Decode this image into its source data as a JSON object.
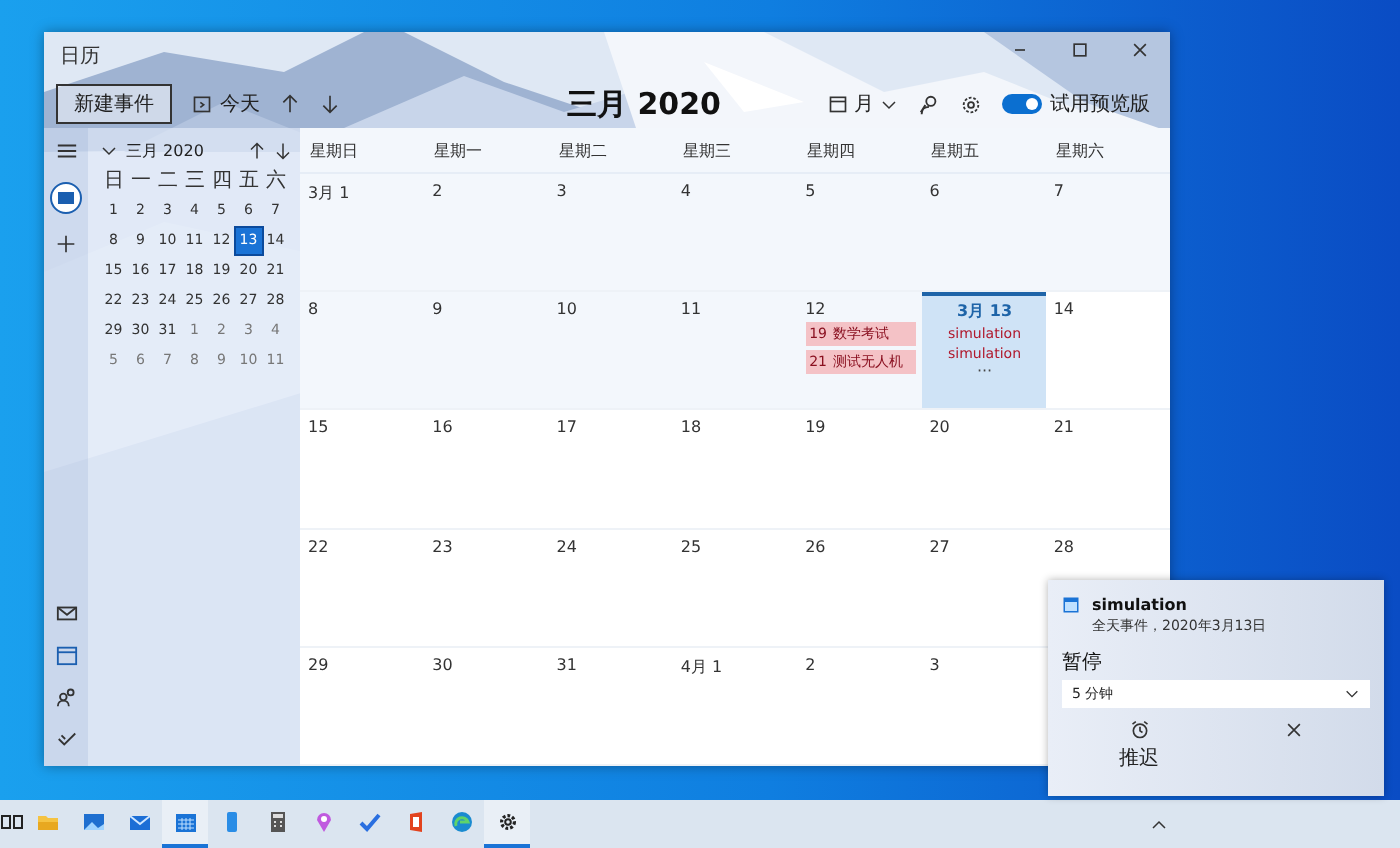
{
  "window": {
    "title": "日历"
  },
  "toolbar": {
    "new_event": "新建事件",
    "today": "今天",
    "month_title": "三月 2020",
    "view": "月",
    "preview_toggle": {
      "label": "试用预览版",
      "on": true
    }
  },
  "mini_calendar": {
    "title": "三月 2020",
    "weekdays": [
      "日",
      "一",
      "二",
      "三",
      "四",
      "五",
      "六"
    ],
    "weeks": [
      [
        {
          "day": "1",
          "in_month": true,
          "selected": false
        },
        {
          "day": "2",
          "in_month": true,
          "selected": false
        },
        {
          "day": "3",
          "in_month": true,
          "selected": false
        },
        {
          "day": "4",
          "in_month": true,
          "selected": false
        },
        {
          "day": "5",
          "in_month": true,
          "selected": false
        },
        {
          "day": "6",
          "in_month": true,
          "selected": false
        },
        {
          "day": "7",
          "in_month": true,
          "selected": false
        }
      ],
      [
        {
          "day": "8",
          "in_month": true,
          "selected": false
        },
        {
          "day": "9",
          "in_month": true,
          "selected": false
        },
        {
          "day": "10",
          "in_month": true,
          "selected": false
        },
        {
          "day": "11",
          "in_month": true,
          "selected": false
        },
        {
          "day": "12",
          "in_month": true,
          "selected": false
        },
        {
          "day": "13",
          "in_month": true,
          "selected": true
        },
        {
          "day": "14",
          "in_month": true,
          "selected": false
        }
      ],
      [
        {
          "day": "15",
          "in_month": true,
          "selected": false
        },
        {
          "day": "16",
          "in_month": true,
          "selected": false
        },
        {
          "day": "17",
          "in_month": true,
          "selected": false
        },
        {
          "day": "18",
          "in_month": true,
          "selected": false
        },
        {
          "day": "19",
          "in_month": true,
          "selected": false
        },
        {
          "day": "20",
          "in_month": true,
          "selected": false
        },
        {
          "day": "21",
          "in_month": true,
          "selected": false
        }
      ],
      [
        {
          "day": "22",
          "in_month": true,
          "selected": false
        },
        {
          "day": "23",
          "in_month": true,
          "selected": false
        },
        {
          "day": "24",
          "in_month": true,
          "selected": false
        },
        {
          "day": "25",
          "in_month": true,
          "selected": false
        },
        {
          "day": "26",
          "in_month": true,
          "selected": false
        },
        {
          "day": "27",
          "in_month": true,
          "selected": false
        },
        {
          "day": "28",
          "in_month": true,
          "selected": false
        }
      ],
      [
        {
          "day": "29",
          "in_month": true,
          "selected": false
        },
        {
          "day": "30",
          "in_month": true,
          "selected": false
        },
        {
          "day": "31",
          "in_month": true,
          "selected": false
        },
        {
          "day": "1",
          "in_month": false,
          "selected": false
        },
        {
          "day": "2",
          "in_month": false,
          "selected": false
        },
        {
          "day": "3",
          "in_month": false,
          "selected": false
        },
        {
          "day": "4",
          "in_month": false,
          "selected": false
        }
      ],
      [
        {
          "day": "5",
          "in_month": false,
          "selected": false
        },
        {
          "day": "6",
          "in_month": false,
          "selected": false
        },
        {
          "day": "7",
          "in_month": false,
          "selected": false
        },
        {
          "day": "8",
          "in_month": false,
          "selected": false
        },
        {
          "day": "9",
          "in_month": false,
          "selected": false
        },
        {
          "day": "10",
          "in_month": false,
          "selected": false
        },
        {
          "day": "11",
          "in_month": false,
          "selected": false
        }
      ]
    ]
  },
  "month_grid": {
    "weekdays": [
      "星期日",
      "星期一",
      "星期二",
      "星期三",
      "星期四",
      "星期五",
      "星期六"
    ],
    "weeks": [
      [
        {
          "label": "3月 1",
          "past": true,
          "today": false
        },
        {
          "label": "2",
          "past": true,
          "today": false
        },
        {
          "label": "3",
          "past": true,
          "today": false
        },
        {
          "label": "4",
          "past": true,
          "today": false
        },
        {
          "label": "5",
          "past": true,
          "today": false
        },
        {
          "label": "6",
          "past": true,
          "today": false
        },
        {
          "label": "7",
          "past": true,
          "today": false
        }
      ],
      [
        {
          "label": "8",
          "past": true,
          "today": false
        },
        {
          "label": "9",
          "past": true,
          "today": false
        },
        {
          "label": "10",
          "past": true,
          "today": false
        },
        {
          "label": "11",
          "past": true,
          "today": false
        },
        {
          "label": "12",
          "past": true,
          "today": false,
          "events": [
            {
              "kind": "timed",
              "time": "19",
              "title": "数学考试"
            },
            {
              "kind": "timed",
              "time": "21",
              "title": "测试无人机"
            }
          ]
        },
        {
          "label": "3月 13",
          "past": false,
          "today": true,
          "events": [
            {
              "kind": "allday",
              "title": "simulation"
            },
            {
              "kind": "allday",
              "title": "simulation"
            }
          ],
          "more": "···"
        },
        {
          "label": "14",
          "past": false,
          "today": false
        }
      ],
      [
        {
          "label": "15",
          "past": false,
          "today": false
        },
        {
          "label": "16",
          "past": false,
          "today": false
        },
        {
          "label": "17",
          "past": false,
          "today": false
        },
        {
          "label": "18",
          "past": false,
          "today": false
        },
        {
          "label": "19",
          "past": false,
          "today": false
        },
        {
          "label": "20",
          "past": false,
          "today": false
        },
        {
          "label": "21",
          "past": false,
          "today": false
        }
      ],
      [
        {
          "label": "22",
          "past": false,
          "today": false
        },
        {
          "label": "23",
          "past": false,
          "today": false
        },
        {
          "label": "24",
          "past": false,
          "today": false
        },
        {
          "label": "25",
          "past": false,
          "today": false
        },
        {
          "label": "26",
          "past": false,
          "today": false
        },
        {
          "label": "27",
          "past": false,
          "today": false
        },
        {
          "label": "28",
          "past": false,
          "today": false
        }
      ],
      [
        {
          "label": "29",
          "past": false,
          "today": false
        },
        {
          "label": "30",
          "past": false,
          "today": false
        },
        {
          "label": "31",
          "past": false,
          "today": false
        },
        {
          "label": "4月 1",
          "past": false,
          "today": false
        },
        {
          "label": "2",
          "past": false,
          "today": false
        },
        {
          "label": "3",
          "past": false,
          "today": false
        }
      ]
    ]
  },
  "notification": {
    "title": "simulation",
    "subtitle": "全天事件，2020年3月13日",
    "snooze_label": "暂停",
    "snooze_value": "5 分钟",
    "snooze_button": "推迟"
  },
  "taskbar": {
    "apps": [
      {
        "kind": "taskview",
        "active": false
      },
      {
        "kind": "folder",
        "active": false
      },
      {
        "kind": "photos",
        "active": false
      },
      {
        "kind": "mail",
        "active": false
      },
      {
        "kind": "calendar",
        "active": true
      },
      {
        "kind": "phone",
        "active": false
      },
      {
        "kind": "calculator",
        "active": false
      },
      {
        "kind": "maps",
        "active": false
      },
      {
        "kind": "todo",
        "active": false
      },
      {
        "kind": "office",
        "active": false
      },
      {
        "kind": "edge",
        "active": false
      },
      {
        "kind": "settings",
        "active": true
      }
    ]
  }
}
